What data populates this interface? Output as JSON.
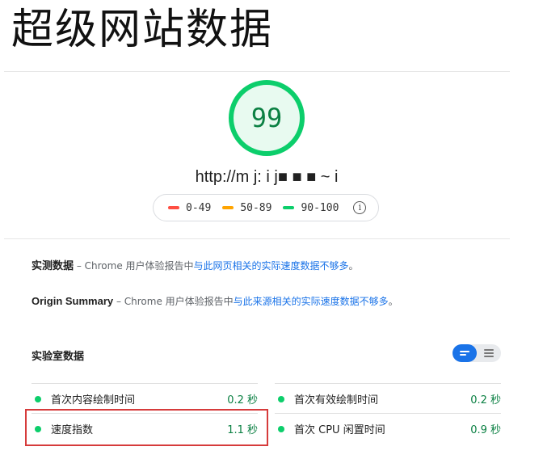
{
  "page_title": "超级网站数据",
  "score": "99",
  "colors": {
    "pass": "#0cce6b",
    "average": "#ffa400",
    "fail": "#ff4e42",
    "link": "#1a73e8",
    "highlight": "#d63b3b"
  },
  "url_text": "http://m j: i j■ ■ ■ ~ i",
  "legend": [
    {
      "range": "0-49",
      "color": "#ff4e42"
    },
    {
      "range": "50-89",
      "color": "#ffa400"
    },
    {
      "range": "90-100",
      "color": "#0cce6b"
    }
  ],
  "field_data": {
    "heading": "实测数据",
    "prefix": " – Chrome 用户体验报告中",
    "link": "与此网页相关的实际速度数据不够多",
    "suffix": "。"
  },
  "origin_summary": {
    "heading": "Origin Summary",
    "prefix": " – Chrome 用户体验报告中",
    "link": "与此来源相关的实际速度数据不够多",
    "suffix": "。"
  },
  "lab": {
    "heading": "实验室数据",
    "metrics_left": [
      {
        "label": "首次内容绘制时间",
        "value": "0.2 秒"
      },
      {
        "label": "速度指数",
        "value": "1.1 秒"
      }
    ],
    "metrics_right": [
      {
        "label": "首次有效绘制时间",
        "value": "0.2 秒"
      },
      {
        "label": "首次 CPU 闲置时间",
        "value": "0.9 秒"
      }
    ]
  }
}
